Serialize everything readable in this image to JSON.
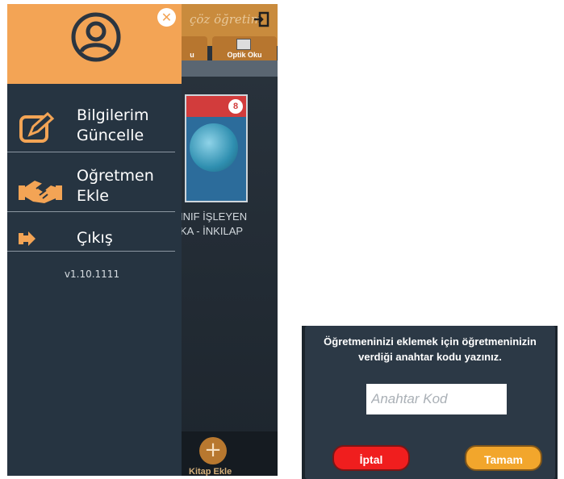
{
  "colors": {
    "drawer_header": "#f3a455",
    "drawer_bg": "#263441",
    "accent": "#f3a455",
    "dialog_bg": "#2c3946",
    "cancel": "#f01e1e",
    "ok": "#f2a62c"
  },
  "background_app": {
    "title": "çöz öğretim",
    "tabs": [
      "u",
      "Optik Oku"
    ],
    "book": {
      "cover_number": "8",
      "title_line1": "INIF İŞLEYEN",
      "title_line2": "KA - İNKILAP"
    },
    "add_book_label": "Kitap Ekle",
    "icons": [
      "login-icon",
      "plus-icon"
    ]
  },
  "drawer": {
    "close_icon": "close-icon",
    "avatar_icon": "user-avatar-icon",
    "items": [
      {
        "icon": "edit-icon",
        "line1": "Bilgilerim",
        "line2": "Güncelle"
      },
      {
        "icon": "handshake-icon",
        "line1": "Oğretmen",
        "line2": "Ekle"
      },
      {
        "icon": "logout-icon",
        "line1": "Çıkış",
        "line2": ""
      }
    ],
    "version": "v1.10.1111"
  },
  "dialog": {
    "message_line1": "Öğretmeninizi eklemek için öğretmeninizin",
    "message_line2": "verdiği anahtar kodu yazınız.",
    "input_placeholder": "Anahtar Kod",
    "input_value": "",
    "cancel_label": "İptal",
    "ok_label": "Tamam"
  }
}
